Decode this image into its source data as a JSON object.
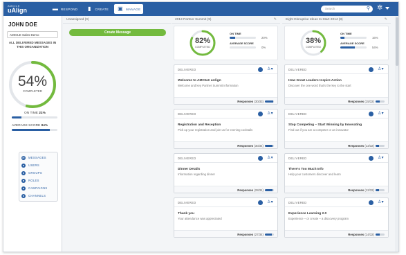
{
  "app": {
    "logo_small": "AMCILE",
    "logo_large": "uAlign",
    "nav": [
      {
        "label": "RESPOND",
        "icon": "chat-icon",
        "active": false
      },
      {
        "label": "CREATE",
        "icon": "document-icon",
        "active": false
      },
      {
        "label": "MANAGE",
        "icon": "person-icon",
        "active": true
      }
    ],
    "search_placeholder": "Search"
  },
  "sidebar": {
    "user_name": "JOHN DOE",
    "org_select": "AMCILE Sales Demo",
    "all_delivered_label": "ALL DELIVERED MESSAGES IN THIS ORGANIZATION",
    "completed_pct_text": "54%",
    "completed_fraction": 0.54,
    "completed_label": "COMPLETED",
    "on_time_label": "ON TIME",
    "on_time_value": "21%",
    "on_time_fraction": 0.21,
    "avg_score_label": "AVERAGE SCORE",
    "avg_score_value": "84%",
    "avg_score_fraction": 0.84,
    "menu": [
      "MESSAGES",
      "USERS",
      "GROUPS",
      "ROLES",
      "CAMPAIGNS",
      "CHANNELS"
    ]
  },
  "columns": [
    {
      "title": "Unassigned (0)",
      "create_label": "Create Message"
    },
    {
      "title": "2013 Partner Summit (9)",
      "completed_pct_text": "82%",
      "completed_fraction": 0.82,
      "completed_label": "COMPLETED",
      "on_time_label": "ON TIME",
      "on_time_value": "20%",
      "on_time_fraction": 0.2,
      "avg_score_label": "AVERAGE SCORE",
      "avg_score_value": "0%",
      "avg_score_fraction": 0.0,
      "cards": [
        {
          "status": "DELIVERED",
          "title": "Welcome to AMCILE uAlign",
          "desc": "Welcome and key Partner Summit information",
          "responses_label": "Responses",
          "responses": "(30/33)",
          "fraction": 0.91
        },
        {
          "status": "DELIVERED",
          "title": "Registration and Reception",
          "desc": "Pick up your registration and join us for evening cocktails",
          "responses_label": "Responses",
          "responses": "(30/34)",
          "fraction": 0.88
        },
        {
          "status": "DELIVERED",
          "title": "Dinner Details",
          "desc": "Information regarding dinner",
          "responses_label": "Responses",
          "responses": "(28/34)",
          "fraction": 0.82
        },
        {
          "status": "DELIVERED",
          "title": "Thank you",
          "desc": "Your attendance was appreciated",
          "responses_label": "Responses",
          "responses": "(27/34)",
          "fraction": 0.79
        }
      ]
    },
    {
      "title": "Eight Disruptive Ideas to Start 2014 (8)",
      "completed_pct_text": "38%",
      "completed_fraction": 0.38,
      "completed_label": "COMPLETED",
      "on_time_label": "ON TIME",
      "on_time_value": "16%",
      "on_time_fraction": 0.16,
      "avg_score_label": "AVERAGE SCORE",
      "avg_score_value": "54%",
      "avg_score_fraction": 0.54,
      "cards": [
        {
          "status": "DELIVERED",
          "title": "How Great Leaders Inspire Action",
          "desc": "Discover the one word that's the key to the start",
          "responses_label": "Responses",
          "responses": "(15/32)",
          "fraction": 0.47
        },
        {
          "status": "DELIVERED",
          "title": "Stop Competing – Start Winning by Innovating",
          "desc": "Find out if you are a competer or an innovator",
          "responses_label": "Responses",
          "responses": "(13/32)",
          "fraction": 0.41
        },
        {
          "status": "DELIVERED",
          "title": "There's Too Much Info",
          "desc": "Help your customers discover and learn",
          "responses_label": "Responses",
          "responses": "(12/32)",
          "fraction": 0.38
        },
        {
          "status": "DELIVERED",
          "title": "Experience Learning 2.0",
          "desc": "Experience – or create – a discovery program",
          "responses_label": "Responses",
          "responses": "(14/32)",
          "fraction": 0.44
        }
      ]
    }
  ],
  "colors": {
    "brand": "#2a5fa3",
    "accent_green": "#73ba3e",
    "ring_track": "#e3e6ea"
  }
}
